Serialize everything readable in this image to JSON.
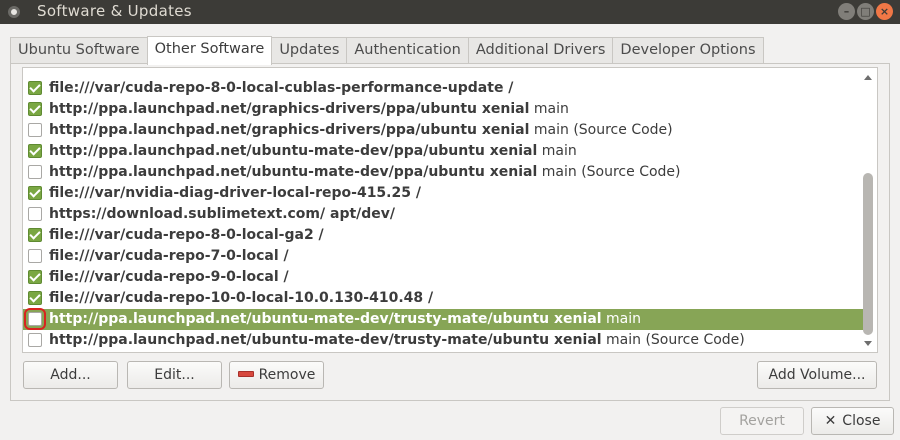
{
  "window": {
    "title": "Software & Updates"
  },
  "tabs": [
    {
      "label": "Ubuntu Software",
      "active": false
    },
    {
      "label": "Other Software",
      "active": true
    },
    {
      "label": "Updates",
      "active": false
    },
    {
      "label": "Authentication",
      "active": false
    },
    {
      "label": "Additional Drivers",
      "active": false
    },
    {
      "label": "Developer Options",
      "active": false
    }
  ],
  "sources": [
    {
      "bold": "file:///var/cuda-repo-8-0-local-cublas-performance-update /",
      "rest": "",
      "checked": true,
      "selected": false
    },
    {
      "bold": "http://ppa.launchpad.net/graphics-drivers/ppa/ubuntu xenial",
      "rest": " main",
      "checked": true,
      "selected": false
    },
    {
      "bold": "http://ppa.launchpad.net/graphics-drivers/ppa/ubuntu xenial",
      "rest": " main (Source Code)",
      "checked": false,
      "selected": false
    },
    {
      "bold": "http://ppa.launchpad.net/ubuntu-mate-dev/ppa/ubuntu xenial",
      "rest": " main",
      "checked": true,
      "selected": false
    },
    {
      "bold": "http://ppa.launchpad.net/ubuntu-mate-dev/ppa/ubuntu xenial",
      "rest": " main (Source Code)",
      "checked": false,
      "selected": false
    },
    {
      "bold": "file:///var/nvidia-diag-driver-local-repo-415.25 /",
      "rest": "",
      "checked": true,
      "selected": false
    },
    {
      "bold": "https://download.sublimetext.com/ apt/dev/",
      "rest": "",
      "checked": false,
      "selected": false
    },
    {
      "bold": "file:///var/cuda-repo-8-0-local-ga2 /",
      "rest": "",
      "checked": true,
      "selected": false
    },
    {
      "bold": "file:///var/cuda-repo-7-0-local /",
      "rest": "",
      "checked": false,
      "selected": false
    },
    {
      "bold": "file:///var/cuda-repo-9-0-local /",
      "rest": "",
      "checked": true,
      "selected": false
    },
    {
      "bold": "file:///var/cuda-repo-10-0-local-10.0.130-410.48 /",
      "rest": "",
      "checked": true,
      "selected": false
    },
    {
      "bold": "http://ppa.launchpad.net/ubuntu-mate-dev/trusty-mate/ubuntu xenial",
      "rest": " main",
      "checked": false,
      "selected": true
    },
    {
      "bold": "http://ppa.launchpad.net/ubuntu-mate-dev/trusty-mate/ubuntu xenial",
      "rest": " main (Source Code)",
      "checked": false,
      "selected": false
    }
  ],
  "buttons": {
    "add": "Add...",
    "edit": "Edit...",
    "remove": "Remove",
    "add_volume": "Add Volume...",
    "revert": "Revert",
    "close": "Close"
  },
  "colors": {
    "selection": "#87a556",
    "check": "#7aa743",
    "highlight_box": "#d8231f",
    "titlebar": "#3c3b37",
    "close_button": "#f07746"
  }
}
